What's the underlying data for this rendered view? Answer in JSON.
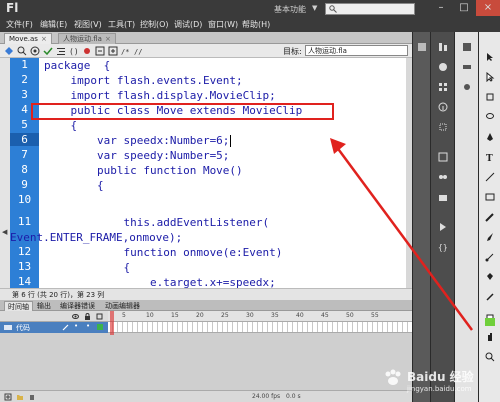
{
  "app": {
    "logo": "Fl",
    "workspace": "基本功能",
    "window_controls": [
      "–",
      "□",
      "×"
    ]
  },
  "menu": [
    "文件(F)",
    "编辑(E)",
    "视图(V)",
    "工具(T)",
    "控制(O)",
    "调试(D)",
    "窗口(W)",
    "帮助(H)"
  ],
  "tabs": [
    {
      "label": "Move.as",
      "active": true
    },
    {
      "label": "人物运动.fla",
      "active": false
    }
  ],
  "toolbar": {
    "target_label": "目标:",
    "target_value": "人物运动.fla"
  },
  "editor": {
    "line_numbers": [
      "1",
      "2",
      "3",
      "4",
      "5",
      "6",
      "7",
      "8",
      "9",
      "10",
      "",
      "11",
      "",
      "12",
      "13",
      "14"
    ],
    "lines": [
      "package  {",
      "    import flash.events.Event;",
      "    import flash.display.MovieClip;",
      "    public class Move extends MovieClip",
      "    {",
      "        var speedx:Number=6;",
      "        var speedy:Number=5;",
      "        public function Move()",
      "        {",
      "",
      "            this.addEventListener(",
      "Event.ENTER_FRAME,onmove);",
      "            function onmove(e:Event)",
      "            {",
      "                e.target.x+=speedx;"
    ],
    "current_line": "6"
  },
  "status": {
    "text": "第 6 行 (共 20 行)，第 23 列"
  },
  "timeline": {
    "tabs": [
      "时间轴",
      "输出",
      "编译器错误",
      "动画编辑器"
    ],
    "ruler": [
      "5",
      "10",
      "15",
      "20",
      "25",
      "30",
      "35",
      "40",
      "45",
      "50",
      "55"
    ],
    "layer_name": "代码",
    "fps": "24.00 fps",
    "time": "0.0 s"
  },
  "watermark": {
    "name": "Baidu 经验",
    "url": "jingyan.baidu.com"
  }
}
